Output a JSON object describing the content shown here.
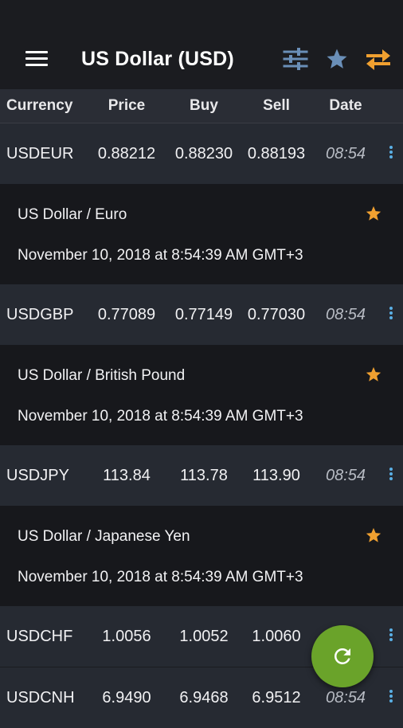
{
  "appbar": {
    "title": "US Dollar (USD)",
    "menu_icon": "hamburger-menu-icon",
    "actions": [
      {
        "icon": "sliders-icon",
        "color": "#6a8fb8"
      },
      {
        "icon": "star-icon",
        "color": "#6a8fb8"
      },
      {
        "icon": "swap-arrows-icon",
        "color": "#f0a030"
      }
    ]
  },
  "columns": [
    "Currency",
    "Price",
    "Buy",
    "Sell",
    "Date"
  ],
  "rates": [
    {
      "symbol": "USDEUR",
      "price": "0.88212",
      "buy": "0.88230",
      "sell": "0.88193",
      "date": "08:54",
      "detail": {
        "name": "US Dollar / Euro",
        "timestamp": "November 10, 2018 at 8:54:39 AM GMT+3",
        "favorite": true
      }
    },
    {
      "symbol": "USDGBP",
      "price": "0.77089",
      "buy": "0.77149",
      "sell": "0.77030",
      "date": "08:54",
      "detail": {
        "name": "US Dollar / British Pound",
        "timestamp": "November 10, 2018 at 8:54:39 AM GMT+3",
        "favorite": true
      }
    },
    {
      "symbol": "USDJPY",
      "price": "113.84",
      "buy": "113.78",
      "sell": "113.90",
      "date": "08:54",
      "detail": {
        "name": "US Dollar / Japanese Yen",
        "timestamp": "November 10, 2018 at 8:54:39 AM GMT+3",
        "favorite": true
      }
    },
    {
      "symbol": "USDCHF",
      "price": "1.0056",
      "buy": "1.0052",
      "sell": "1.0060",
      "date": ""
    },
    {
      "symbol": "USDCNH",
      "price": "6.9490",
      "buy": "6.9468",
      "sell": "6.9512",
      "date": "08:54"
    }
  ],
  "colors": {
    "accent_blue": "#5ab0e6",
    "star_orange": "#f0a030",
    "fab_green": "#6aa32a"
  },
  "fab": {
    "icon": "refresh-icon"
  }
}
